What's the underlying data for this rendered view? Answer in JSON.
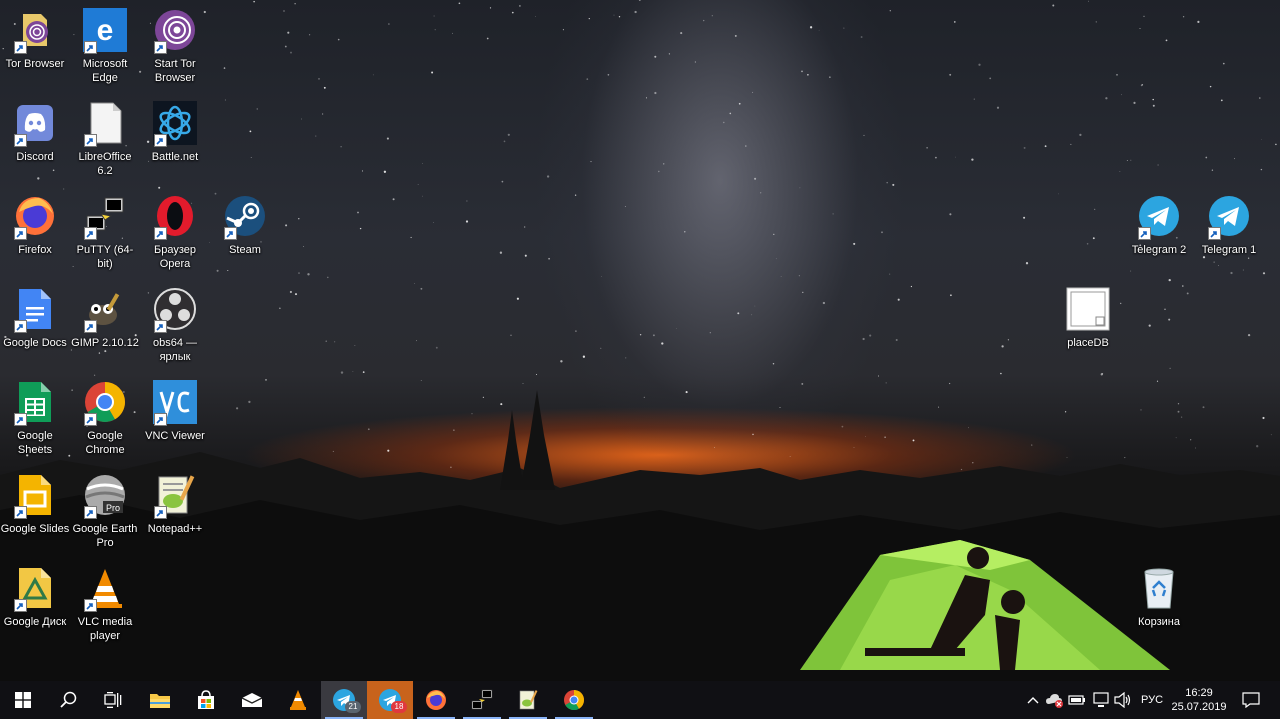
{
  "desktop": {
    "icons": [
      {
        "label": "Tor Browser",
        "icon": "tor-browser-icon"
      },
      {
        "label": "Microsoft Edge",
        "icon": "edge-icon"
      },
      {
        "label": "Start Tor Browser",
        "icon": "tor-icon"
      },
      {
        "label": "Discord",
        "icon": "discord-icon"
      },
      {
        "label": "LibreOffice 6.2",
        "icon": "libreoffice-icon"
      },
      {
        "label": "Battle.net",
        "icon": "battlenet-icon"
      },
      {
        "label": "Firefox",
        "icon": "firefox-icon"
      },
      {
        "label": "PuTTY (64-bit)",
        "icon": "putty-icon"
      },
      {
        "label": "Браузер Opera",
        "icon": "opera-icon"
      },
      {
        "label": "Steam",
        "icon": "steam-icon"
      },
      {
        "label": "Google Docs",
        "icon": "google-docs-icon"
      },
      {
        "label": "GIMP 2.10.12",
        "icon": "gimp-icon"
      },
      {
        "label": "obs64 — ярлык",
        "icon": "obs-icon"
      },
      {
        "label": "Google Sheets",
        "icon": "google-sheets-icon"
      },
      {
        "label": "Google Chrome",
        "icon": "chrome-icon"
      },
      {
        "label": "VNC Viewer",
        "icon": "vnc-icon"
      },
      {
        "label": "Google Slides",
        "icon": "google-slides-icon"
      },
      {
        "label": "Google Earth Pro",
        "icon": "google-earth-icon"
      },
      {
        "label": "Notepad++",
        "icon": "notepadpp-icon"
      },
      {
        "label": "Google Диск",
        "icon": "google-drive-icon"
      },
      {
        "label": "VLC media player",
        "icon": "vlc-icon"
      },
      {
        "label": "Telegram 2",
        "icon": "telegram-icon"
      },
      {
        "label": "Telegram 1",
        "icon": "telegram-icon"
      },
      {
        "label": "placeDB",
        "icon": "file-icon"
      },
      {
        "label": "Корзина",
        "icon": "recycle-bin-icon"
      }
    ],
    "earth_pro_tag": "Pro"
  },
  "taskbar": {
    "telegram2_badge": "21",
    "telegram1_badge": "18",
    "language": "РУС",
    "time": "16:29",
    "date": "25.07.2019"
  },
  "colors": {
    "taskbar_bg": "#101014",
    "active_app_bg": "#c8631c",
    "telegram_blue": "#2ca5e0"
  }
}
